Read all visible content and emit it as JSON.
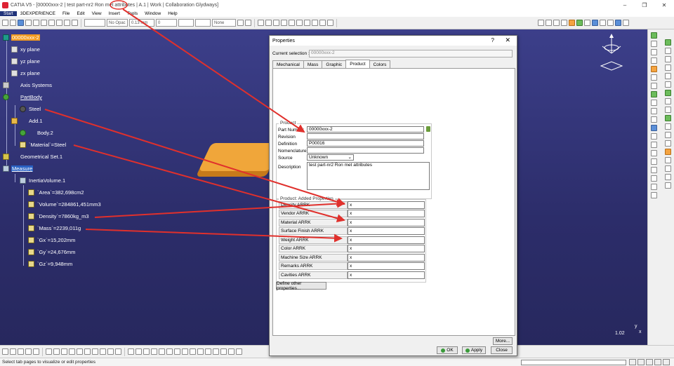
{
  "window": {
    "title": "CATIA V5 - [00000xxx-2 | test part-nr2 Ron met attributes | A.1 | Work | Collaboration Glydways]",
    "controls": [
      "–",
      "❐",
      "✕"
    ]
  },
  "menu": [
    "Start",
    "3DEXPERIENCE",
    "File",
    "Edit",
    "View",
    "Insert",
    "Tools",
    "Window",
    "Help"
  ],
  "toolbar": {
    "opacity": "No Opac",
    "line_weight": "0.13 mm",
    "line_type": "0",
    "layer": "None"
  },
  "tree": {
    "root": "00000xxx-2",
    "planes": [
      "xy plane",
      "yz plane",
      "zx plane"
    ],
    "axis_systems": "Axis Systems",
    "partbody": "PartBody",
    "material": "Steel",
    "add": "Add.1",
    "body2": "Body.2",
    "material_param": "`Material`=Steel",
    "geo_set": "Geometrical Set.1",
    "measure": "Measure",
    "inertia": "InertiaVolume.1",
    "params": [
      "`Area`=382,698cm2",
      "`Volume`=284861,451mm3",
      "`Density`=7860kg_m3",
      "`Mass`=2239,011g",
      "`Gx`=15,202mm",
      "`Gy`=24,676mm",
      "`Gz`=9,948mm"
    ]
  },
  "viewport": {
    "scale": "1.02",
    "axis_x": "x",
    "axis_y": "y"
  },
  "dialog": {
    "title": "Properties",
    "help": "?",
    "close": "✕",
    "current_selection_label": "Current selection :",
    "current_selection_value": "00000xxx-2",
    "tabs": [
      "Mechanical",
      "Mass",
      "Graphic",
      "Product",
      "Colors"
    ],
    "active_tab": "Product",
    "product_group": "Product",
    "fields": {
      "part_number_label": "Part Number",
      "part_number": "00000xxx-2",
      "revision_label": "Revision",
      "revision": "",
      "definition_label": "Definition",
      "definition": "P00016",
      "nomenclature_label": "Nomenclature",
      "nomenclature": "",
      "source_label": "Source",
      "source": "Unknown",
      "description_label": "Description",
      "description": "test part-nr2 Ron met attributes"
    },
    "added_group": "Product: Added Properties",
    "added_properties": [
      {
        "name": "Density ARRK",
        "value": "x"
      },
      {
        "name": "Vendor ARRK",
        "value": "x"
      },
      {
        "name": "Material ARRK",
        "value": "x"
      },
      {
        "name": "Surface Finish ARRK",
        "value": "x"
      },
      {
        "name": "Weight ARRK",
        "value": "x"
      },
      {
        "name": "Color ARRK",
        "value": "x"
      },
      {
        "name": "Machine Size ARRK",
        "value": "x"
      },
      {
        "name": "Remarks ARRK",
        "value": "x"
      },
      {
        "name": "Cavities ARRK",
        "value": "x"
      }
    ],
    "define_other": "Define other properties...",
    "more": "More...",
    "ok": "OK",
    "apply": "Apply",
    "close_btn": "Close"
  },
  "status": {
    "text": "Select tab pages to visualize or edit properties"
  },
  "colors": {
    "annotation": "#e0302c",
    "highlight": "#f39a1e",
    "selection": "#2a62c4"
  }
}
